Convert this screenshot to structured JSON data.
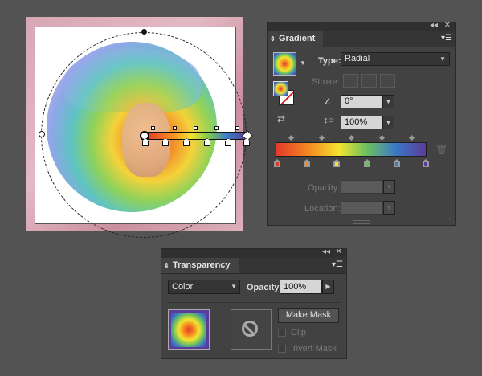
{
  "colors": {
    "bg": "#535353",
    "panel": "#424242"
  },
  "gradient_panel": {
    "collapse_icon": "double-left-chevron",
    "close_icon": "close-x",
    "tab_title": "Gradient",
    "menu_icon": "panel-menu",
    "type_label": "Type:",
    "type_value": "Radial",
    "stroke_label": "Stroke:",
    "angle_icon": "angle-icon",
    "angle_value": "0°",
    "aspect_icon": "aspect-ratio-icon",
    "aspect_value": "100%",
    "reverse_icon": "reverse-gradient-icon",
    "trash_icon": "trash-icon",
    "opacity_label": "Opacity:",
    "opacity_value": "",
    "location_label": "Location:",
    "location_value": "",
    "stop_colors": [
      "#e33a2a",
      "#f58a22",
      "#f4e430",
      "#6fc15d",
      "#3a78c8",
      "#5b3b98"
    ]
  },
  "transparency_panel": {
    "collapse_icon": "double-left-chevron",
    "close_icon": "close-x",
    "tab_title": "Transparency",
    "menu_icon": "panel-menu",
    "blend_mode": "Color",
    "opacity_label": "Opacity:",
    "opacity_value": "100%",
    "make_mask_label": "Make Mask",
    "clip_label": "Clip",
    "invert_mask_label": "Invert Mask"
  }
}
